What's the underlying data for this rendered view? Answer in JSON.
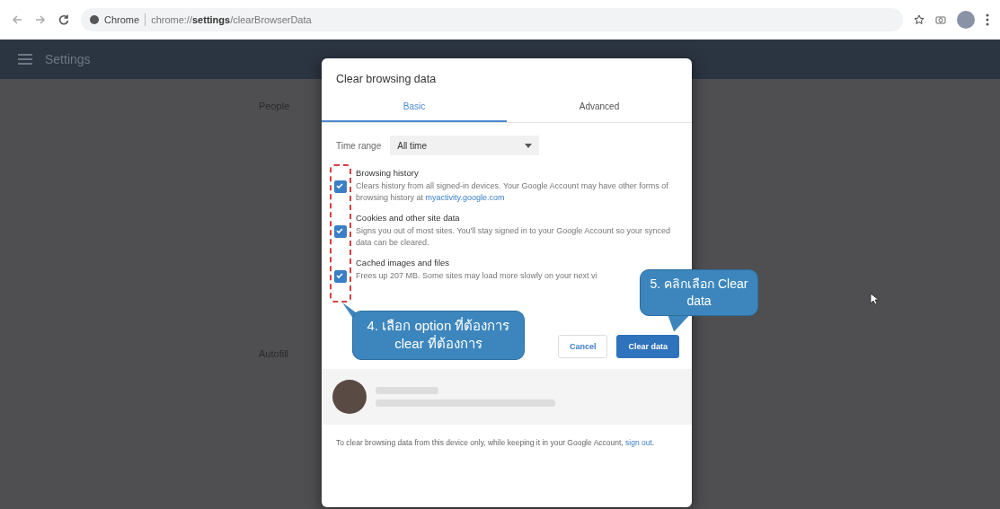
{
  "browser": {
    "origin_chip": "Chrome",
    "url": "chrome://**settings**/clearBrowserData"
  },
  "settings_header": {
    "title": "Settings"
  },
  "background": {
    "section_1": "People",
    "section_2": "Autofill"
  },
  "dialog": {
    "title": "Clear browsing data",
    "tabs": [
      {
        "label": "Basic",
        "selected": true
      },
      {
        "label": "Advanced",
        "selected": false
      }
    ],
    "time_range": {
      "label": "Time range",
      "value": "All time"
    },
    "items": [
      {
        "title": "Browsing history",
        "description": "Clears history from all signed-in devices. Your Google Account may have other forms of browsing history at ",
        "link": "myactivity.google.com",
        "checked": true
      },
      {
        "title": "Cookies and other site data",
        "description": "Signs you out of most sites. You'll stay signed in to your Google Account so your synced data can be cleared.",
        "checked": true
      },
      {
        "title": "Cached images and files",
        "description": "Frees up 207 MB. Some sites may load more slowly on your next vi",
        "checked": true
      }
    ],
    "buttons": [
      "Cancel",
      "Clear data"
    ],
    "footer": {
      "text": "To clear browsing data from this device only, while keeping it in your Google Account, ",
      "link": "sign out",
      "end": "."
    }
  },
  "callouts": [
    "4. เลือก option ที่ต้องการ clear ที่ต้องการ",
    "5. คลิกเลือก Clear data"
  ]
}
